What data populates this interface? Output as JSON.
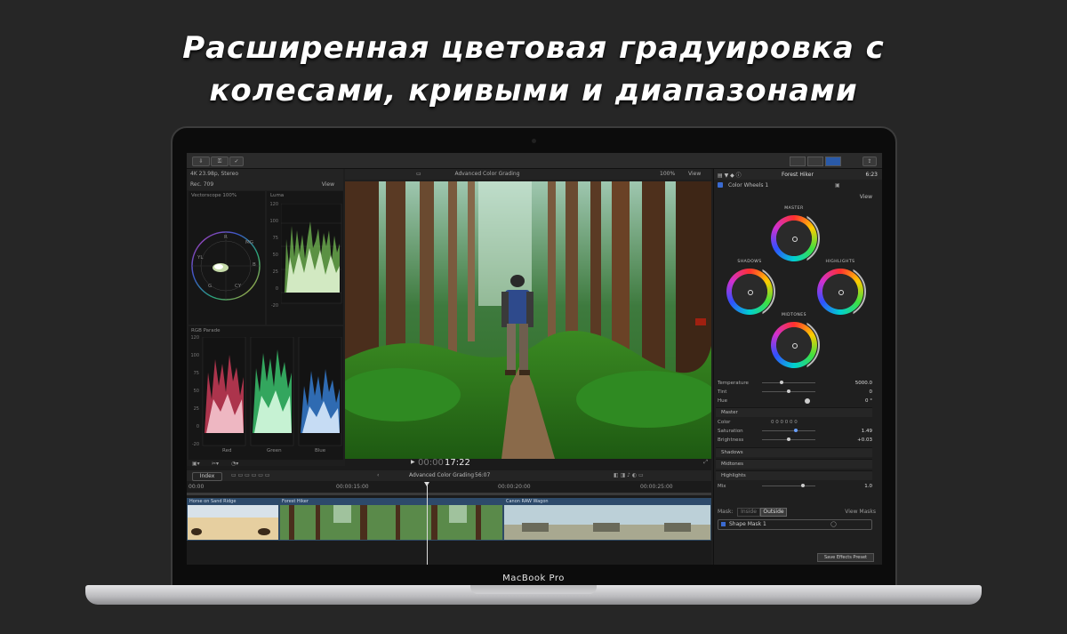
{
  "headline": {
    "line1_cap": "Р",
    "line1_rest": "асширенная цветовая градуировка с",
    "line2": "колесами, кривыми и диапазонами"
  },
  "laptop": {
    "brand": "MacBook Pro"
  },
  "app": {
    "format_info": "4K 23.98p, Stereo",
    "viewer_title": "Advanced Color Grading",
    "zoom": "100%",
    "view_label": "View",
    "timecode": "00:00:17:22",
    "timecode_dim": "00:00",
    "timecode_main": "17:22"
  },
  "scopes": {
    "colorspace": "Rec. 709",
    "view_label": "View",
    "vectorscope_label": "Vectorscope",
    "vectorscope_zoom": "100%",
    "luma_label": "Luma",
    "luma_ticks": [
      "120",
      "100",
      "75",
      "50",
      "25",
      "0",
      "-20"
    ],
    "parade_label": "RGB Parade",
    "parade_ticks": [
      "120",
      "100",
      "75",
      "50",
      "25",
      "0",
      "-20"
    ],
    "parade_channels": [
      "Red",
      "Green",
      "Blue"
    ],
    "vector_marks": [
      "R",
      "MG",
      "YL",
      "B",
      "G",
      "CY"
    ]
  },
  "inspector": {
    "clip_name": "Forest Hiker",
    "duration": "6:23",
    "effect_name": "Color Wheels 1",
    "view_label": "View",
    "wheels": [
      "MASTER",
      "SHADOWS",
      "HIGHLIGHTS",
      "MIDTONES"
    ],
    "params": [
      {
        "label": "Temperature",
        "value": "5000.0"
      },
      {
        "label": "Tint",
        "value": "0"
      },
      {
        "label": "Hue",
        "value": "0 °"
      }
    ],
    "master_section": "Master",
    "master_rows": [
      {
        "label": "Color",
        "value": "0   0   0   0   0   0"
      },
      {
        "label": "Saturation",
        "value": "1.49"
      },
      {
        "label": "Brightness",
        "value": "+0.03"
      }
    ],
    "sections": [
      "Shadows",
      "Midtones",
      "Highlights"
    ],
    "mix": {
      "label": "Mix",
      "value": "1.0"
    },
    "mask": {
      "label": "Mask:",
      "inside": "Inside",
      "outside": "Outside",
      "view_masks": "View Masks"
    },
    "shape_mask": "Shape Mask 1",
    "save_preset": "Save Effects Preset"
  },
  "timeline": {
    "index_label": "Index",
    "project_name": "Advanced Color Grading",
    "project_duration": "56:07",
    "ruler": [
      "00:00",
      "00:00:15:00",
      "00:00:20:00",
      "00:00:25:00"
    ],
    "clips": [
      "Horse on Sand Ridge",
      "Forest Hiker",
      "Canon RAW Wagon"
    ]
  },
  "colors": {
    "background": "#262626",
    "headline": "#ffffff",
    "clip_header": "#2d4a6b"
  }
}
